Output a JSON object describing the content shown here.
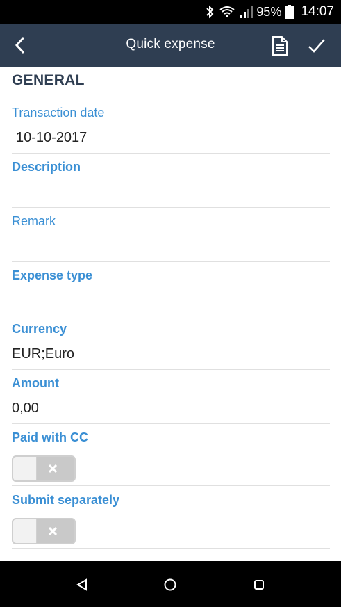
{
  "status_bar": {
    "battery_percent": "95%",
    "time": "14:07",
    "icons": [
      "bluetooth-icon",
      "wifi-icon",
      "signal-icon",
      "battery-icon"
    ]
  },
  "app_bar": {
    "title": "Quick expense",
    "back_icon": "back-arrow-icon",
    "document_icon": "document-icon",
    "confirm_icon": "checkmark-icon",
    "background_color": "#2f3e52"
  },
  "form": {
    "section_title": "GENERAL",
    "label_color": "#3a8fd4",
    "fields": {
      "transaction_date": {
        "label": "Transaction date",
        "value": "10-10-2017"
      },
      "description": {
        "label": "Description",
        "value": ""
      },
      "remark": {
        "label": "Remark",
        "value": ""
      },
      "expense_type": {
        "label": "Expense type",
        "value": ""
      },
      "currency": {
        "label": "Currency",
        "value": "EUR;Euro"
      },
      "amount": {
        "label": "Amount",
        "value": "0,00"
      },
      "paid_with_cc": {
        "label": "Paid with CC",
        "checked": false
      },
      "submit_separately": {
        "label": "Submit separately",
        "checked": false
      }
    }
  },
  "nav_bar": {
    "icons": [
      "nav-back-icon",
      "nav-home-icon",
      "nav-recents-icon"
    ]
  }
}
